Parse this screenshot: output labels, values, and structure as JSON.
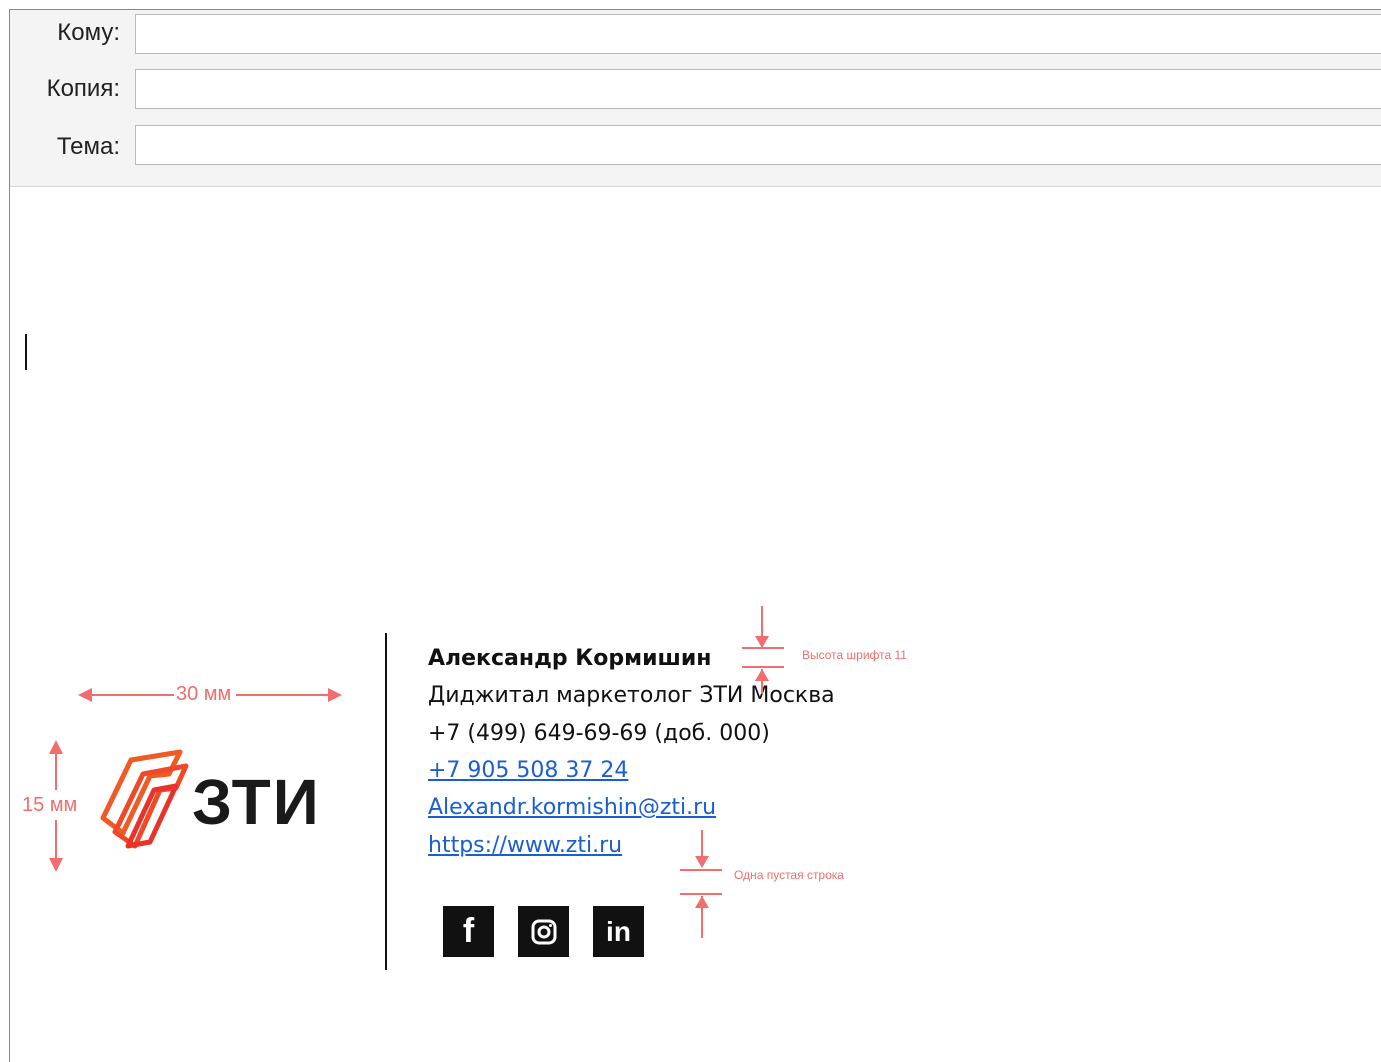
{
  "header": {
    "to_label": "Кому:",
    "cc_label": "Копия:",
    "subject_label": "Тема:",
    "to_value": "",
    "cc_value": "",
    "subject_value": ""
  },
  "signature": {
    "name": "Александр Кормишин",
    "title": "Диджитал маркетолог ЗТИ Москва",
    "phone_office": "+7 (499) 649-69-69 (доб. 000)",
    "phone_mobile": "+7 905 508 37 24",
    "email": "Alexandr.kormishin@zti.ru",
    "website": "https://www.zti.ru",
    "logo_text": "ЗТИ",
    "social_labels": [
      "f",
      "in"
    ],
    "social_icons": [
      "facebook-icon",
      "instagram-icon",
      "linkedin-icon"
    ]
  },
  "annotations": {
    "width": "30 мм",
    "height": "15 мм",
    "font_height": "Высота шрифта 11",
    "empty_line": "Одна пустая строка"
  },
  "colors": {
    "annotation": "#f26d6d",
    "link": "#1a5fd1",
    "logo_orange": "#f05a24",
    "logo_red": "#e8332a"
  }
}
